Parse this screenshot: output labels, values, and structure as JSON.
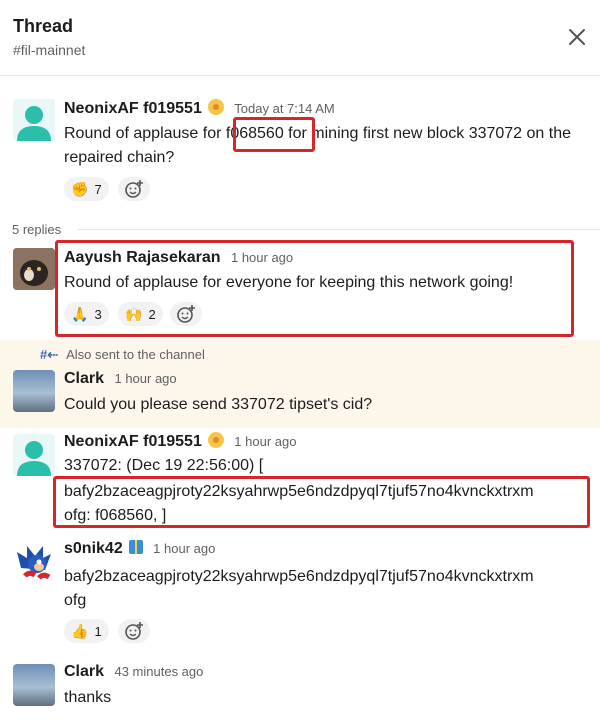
{
  "header": {
    "title": "Thread",
    "channel": "#fil-mainnet"
  },
  "replies_count": "5 replies",
  "also_sent": "Also sent to the channel",
  "messages": [
    {
      "author": "NeonixAF f019551",
      "time": "Today at 7:14 AM",
      "text_before": "Round of applause for ",
      "text_highlight": "f068560",
      "text_after": " for mining first new block 337072 on the repaired chain?",
      "reactions": [
        {
          "emoji": "✊",
          "count": "7"
        }
      ]
    },
    {
      "author": "Aayush Rajasekaran",
      "time": "1 hour ago",
      "text": "Round of applause for everyone for keeping this network going!",
      "reactions": [
        {
          "emoji": "🙏",
          "count": "3"
        },
        {
          "emoji": "🙌",
          "count": "2"
        }
      ]
    },
    {
      "author": "Clark",
      "time": "1 hour ago",
      "text": "Could you please send 337072 tipset's cid?"
    },
    {
      "author": "NeonixAF f019551",
      "time": "1 hour ago",
      "line1": "337072: (Dec 19 22:56:00) [",
      "line2": "bafy2bzaceagpjroty22ksyahrwp5e6ndzdpyql7tjuf57no4kvnckxtrxm",
      "line3": "ofg: f068560, ]"
    },
    {
      "author": "s0nik42",
      "time": "1 hour ago",
      "line1": "bafy2bzaceagpjroty22ksyahrwp5e6ndzdpyql7tjuf57no4kvnckxtrxm",
      "line2": "ofg",
      "reactions": [
        {
          "emoji": "👍",
          "count": "1"
        }
      ]
    },
    {
      "author": "Clark",
      "time": "43 minutes ago",
      "text": "thanks"
    }
  ],
  "colors": {
    "highlight": "#d7262a",
    "teal_avatar": "#2bbfab",
    "band": "#fdf6ea"
  }
}
